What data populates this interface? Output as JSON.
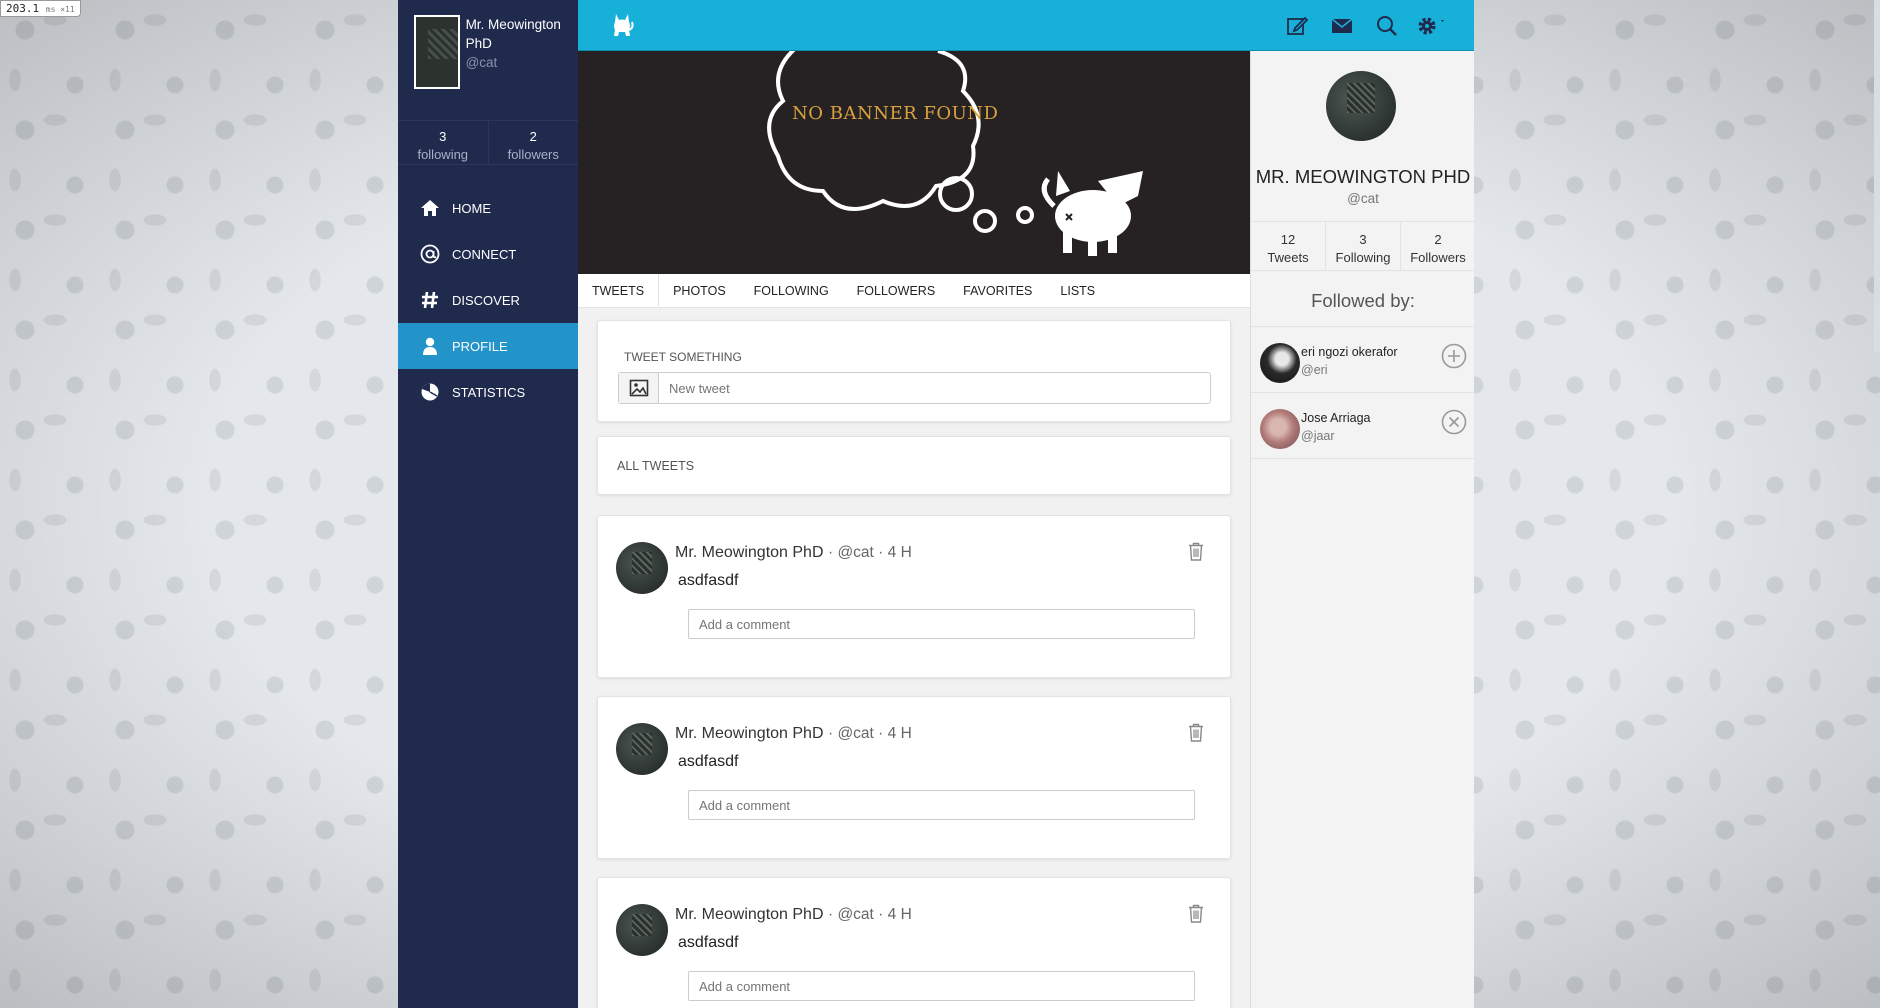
{
  "perf": {
    "value": "203.1",
    "unit": "ms ×11"
  },
  "sidebar": {
    "user": {
      "name": "Mr. Meowington PhD",
      "handle": "@cat"
    },
    "counts": [
      {
        "num": "3",
        "label": "following"
      },
      {
        "num": "2",
        "label": "followers"
      }
    ],
    "nav": [
      {
        "label": "HOME",
        "icon": "home-icon"
      },
      {
        "label": "CONNECT",
        "icon": "at-icon"
      },
      {
        "label": "DISCOVER",
        "icon": "hash-icon"
      },
      {
        "label": "PROFILE",
        "icon": "person-icon",
        "active": true
      },
      {
        "label": "STATISTICS",
        "icon": "pie-chart-icon"
      }
    ]
  },
  "topbar": {
    "icons": [
      "compose-icon",
      "envelope-icon",
      "search-icon",
      "gear-icon"
    ],
    "accent": "#17b0d8"
  },
  "banner": {
    "text": "NO BANNER FOUND"
  },
  "tabs": [
    "TWEETS",
    "PHOTOS",
    "FOLLOWING",
    "FOLLOWERS",
    "FAVORITES",
    "LISTS"
  ],
  "compose": {
    "label": "TWEET SOMETHING",
    "placeholder": "New tweet"
  },
  "all_tweets_label": "ALL TWEETS",
  "tweets": [
    {
      "name": "Mr. Meowington PhD",
      "handle": "@cat",
      "time": "4 H",
      "text": "asdfasdf",
      "comment_placeholder": "Add a comment"
    },
    {
      "name": "Mr. Meowington PhD",
      "handle": "@cat",
      "time": "4 H",
      "text": "asdfasdf",
      "comment_placeholder": "Add a comment"
    },
    {
      "name": "Mr. Meowington PhD",
      "handle": "@cat",
      "time": "4 H",
      "text": "asdfasdf",
      "comment_placeholder": "Add a comment"
    }
  ],
  "profile": {
    "name": "MR. MEOWINGTON PHD",
    "handle": "@cat",
    "stats": [
      {
        "num": "12",
        "label": "Tweets"
      },
      {
        "num": "3",
        "label": "Following"
      },
      {
        "num": "2",
        "label": "Followers"
      }
    ],
    "followed_by_title": "Followed by:",
    "followed_by": [
      {
        "name": "eri ngozi okerafor",
        "handle": "@eri",
        "action": "follow"
      },
      {
        "name": "Jose Arriaga",
        "handle": "@jaar",
        "action": "unfollow"
      }
    ]
  },
  "colors": {
    "sidebar": "#1f2a4d",
    "active": "#2394c9",
    "banner_text": "#d9a23e"
  }
}
